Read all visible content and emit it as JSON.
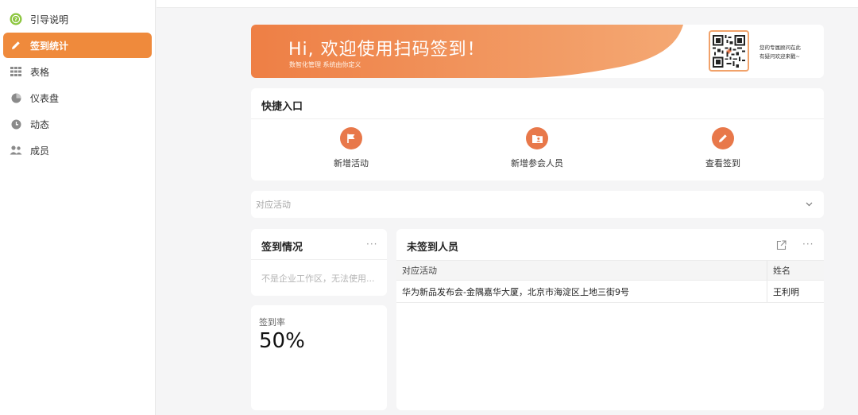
{
  "sidebar": {
    "items": [
      {
        "label": "引导说明",
        "icon": "help-circle-icon"
      },
      {
        "label": "签到统计",
        "icon": "pencil-icon",
        "active": true
      },
      {
        "label": "表格",
        "icon": "grid-icon"
      },
      {
        "label": "仪表盘",
        "icon": "pie-chart-icon"
      },
      {
        "label": "动态",
        "icon": "clock-icon"
      },
      {
        "label": "成员",
        "icon": "members-icon"
      }
    ]
  },
  "banner": {
    "title": "Hi, 欢迎使用扫码签到！",
    "subtitle": "数智化管理 系统由你定义",
    "qr_note_line1": "您的专属顾问在此",
    "qr_note_line2": "有疑问欢迎来戳~"
  },
  "quick": {
    "title": "快捷入口",
    "items": [
      {
        "label": "新增活动",
        "icon": "flag-icon"
      },
      {
        "label": "新增参会人员",
        "icon": "contact-card-icon"
      },
      {
        "label": "查看签到",
        "icon": "pencil-icon"
      }
    ]
  },
  "filter": {
    "placeholder": "对应活动"
  },
  "status": {
    "title": "签到情况",
    "more": "···",
    "message": "不是企业工作区，无法使用..."
  },
  "rate": {
    "label": "签到率",
    "value": "50%"
  },
  "absent": {
    "title": "未签到人员",
    "more": "···",
    "columns": [
      "对应活动",
      "姓名"
    ],
    "rows": [
      [
        "华为新品发布会-金隅嘉华大厦，北京市海淀区上地三街9号",
        "王利明"
      ]
    ]
  },
  "colors": {
    "accent": "#ef8a3c",
    "banner_start": "#ee7f45",
    "banner_end": "#f4a873",
    "quick_icon_bg": "#e8784a"
  }
}
